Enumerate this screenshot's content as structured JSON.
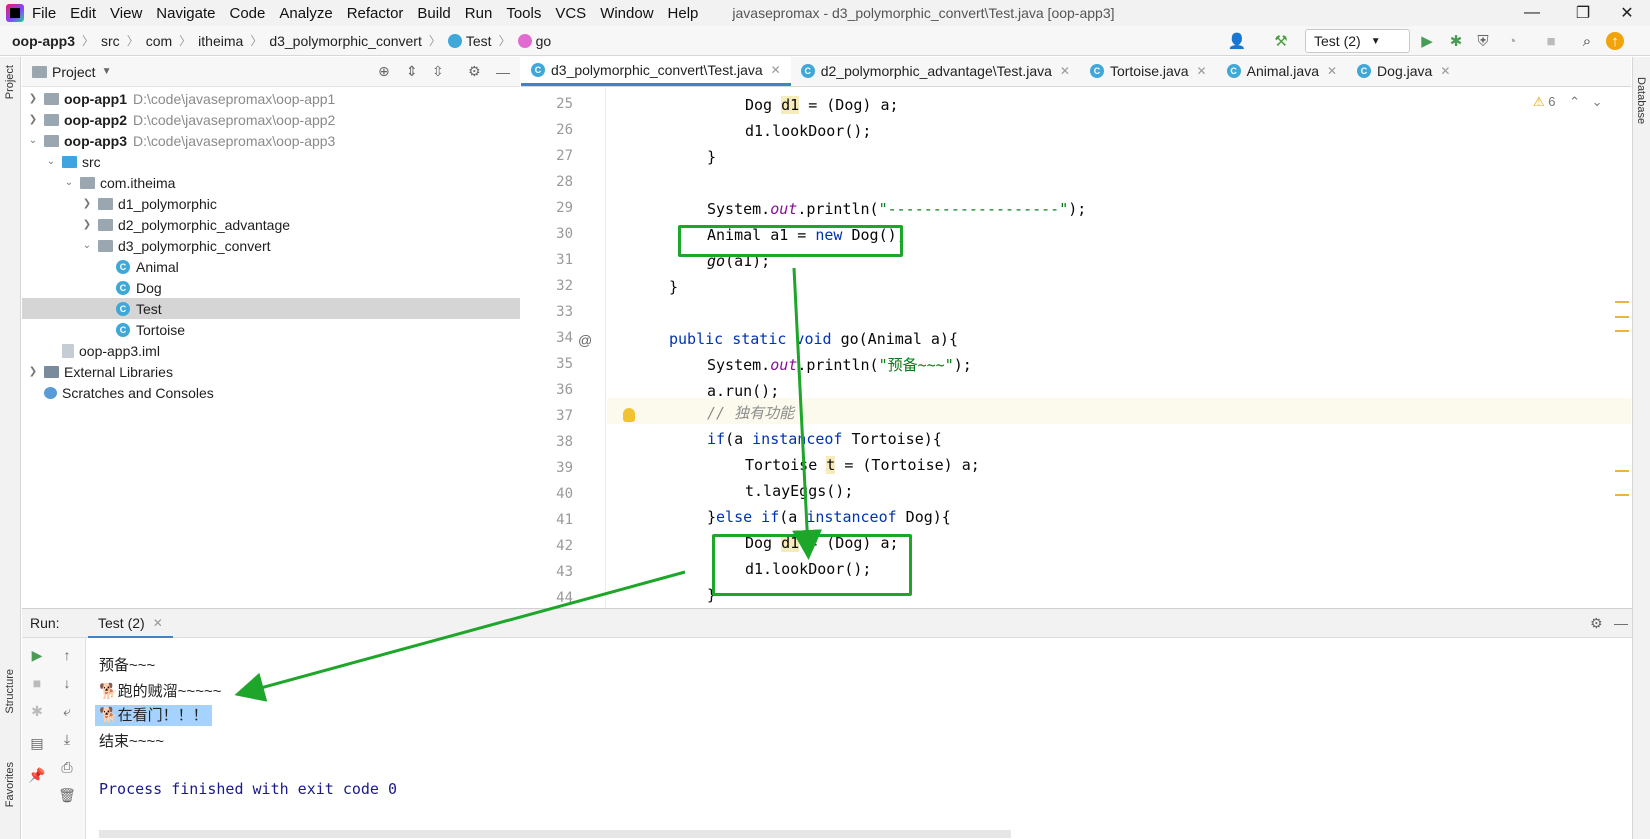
{
  "menubar": {
    "items": [
      "File",
      "Edit",
      "View",
      "Navigate",
      "Code",
      "Analyze",
      "Refactor",
      "Build",
      "Run",
      "Tools",
      "VCS",
      "Window",
      "Help"
    ],
    "window_title": "javasepromax - d3_polymorphic_convert\\Test.java [oop-app3]"
  },
  "breadcrumb": [
    "oop-app3",
    "src",
    "com",
    "itheima",
    "d3_polymorphic_convert",
    "Test",
    "go"
  ],
  "toolbar": {
    "run_config": "Test (2)"
  },
  "project": {
    "title": "Project",
    "tree": [
      {
        "label": "oop-app1",
        "path": "D:\\code\\javasepromax\\oop-app1"
      },
      {
        "label": "oop-app2",
        "path": "D:\\code\\javasepromax\\oop-app2"
      },
      {
        "label": "oop-app3",
        "path": "D:\\code\\javasepromax\\oop-app3"
      },
      {
        "label": "src"
      },
      {
        "label": "com.itheima"
      },
      {
        "label": "d1_polymorphic"
      },
      {
        "label": "d2_polymorphic_advantage"
      },
      {
        "label": "d3_polymorphic_convert"
      },
      {
        "label": "Animal"
      },
      {
        "label": "Dog"
      },
      {
        "label": "Test"
      },
      {
        "label": "Tortoise"
      },
      {
        "label": "oop-app3.iml"
      },
      {
        "label": "External Libraries"
      },
      {
        "label": "Scratches and Consoles"
      }
    ]
  },
  "tabs": [
    "d3_polymorphic_convert\\Test.java",
    "d2_polymorphic_advantage\\Test.java",
    "Tortoise.java",
    "Animal.java",
    "Dog.java"
  ],
  "editor": {
    "warnings": "6",
    "line_numbers": [
      "25",
      "26",
      "27",
      "28",
      "29",
      "30",
      "31",
      "32",
      "33",
      "34",
      "35",
      "36",
      "37",
      "38",
      "39",
      "40",
      "41",
      "42",
      "43",
      "44"
    ],
    "code": {
      "l25": [
        "Dog ",
        "d1",
        " = (Dog) a;"
      ],
      "l26": "d1.lookDoor();",
      "l27": "}",
      "l29": [
        "System.",
        "out",
        ".println(",
        "\"-------------------\"",
        ");"
      ],
      "l30": [
        "Animal a1 = ",
        "new",
        " Dog();"
      ],
      "l31": [
        "go",
        "(a1);"
      ],
      "l32": "}",
      "l34": [
        "public static void",
        " go(Animal a){"
      ],
      "l35": [
        "System.",
        "out",
        ".println(",
        "\"预备~~~\"",
        ");"
      ],
      "l36": "a.run();",
      "l37": "// 独有功能",
      "l38": [
        "if",
        "(a ",
        "instanceof",
        " Tortoise){"
      ],
      "l39": [
        "Tortoise ",
        "t",
        " = (Tortoise) a;"
      ],
      "l40": "t.layEggs();",
      "l41": [
        "}",
        "else if",
        "(a ",
        "instanceof",
        " Dog){"
      ],
      "l42": [
        "Dog ",
        "d1",
        " = (Dog) a;"
      ],
      "l43": "d1.lookDoor();",
      "l44": "}"
    }
  },
  "run": {
    "label": "Run:",
    "tab": "Test (2)",
    "output": [
      "预备~~~",
      "🐕跑的贼溜~~~~~",
      "🐕在看门！！！",
      "结束~~~~",
      "Process finished with exit code 0"
    ]
  },
  "left_stripe": {
    "project": "Project",
    "structure": "Structure",
    "favorites": "Favorites"
  },
  "right_stripe": {
    "database": "Database"
  },
  "colors": {
    "annotation_green": "#1ea62a",
    "accent_blue": "#4083c9"
  }
}
